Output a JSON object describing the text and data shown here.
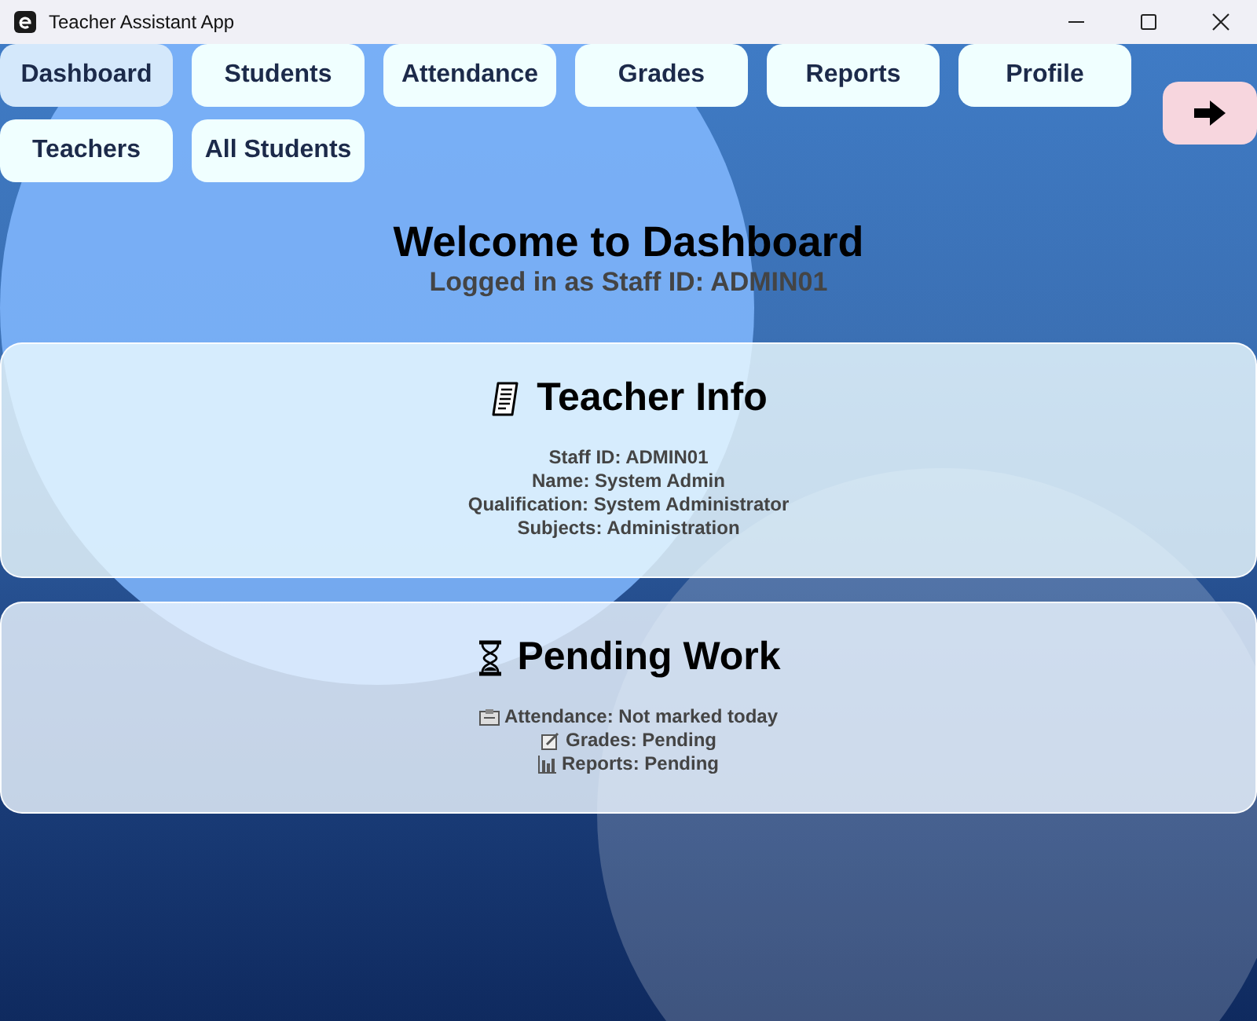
{
  "window": {
    "title": "Teacher Assistant App"
  },
  "tabs": [
    {
      "label": "Dashboard",
      "selected": true
    },
    {
      "label": "Students",
      "selected": false
    },
    {
      "label": "Attendance",
      "selected": false
    },
    {
      "label": "Grades",
      "selected": false
    },
    {
      "label": "Reports",
      "selected": false
    },
    {
      "label": "Profile",
      "selected": false
    },
    {
      "label": "Teachers",
      "selected": false
    },
    {
      "label": "All Students",
      "selected": false
    }
  ],
  "heading": "Welcome to Dashboard",
  "subheading": "Logged in as Staff ID: ADMIN01",
  "teacher_info": {
    "title": "Teacher Info",
    "lines": [
      "Staff ID: ADMIN01",
      "Name: System Admin",
      "Qualification: System Administrator",
      "Subjects: Administration"
    ]
  },
  "pending_work": {
    "title": "Pending Work",
    "items": [
      {
        "kind": "attendance",
        "text": "Attendance: Not marked today"
      },
      {
        "kind": "grades",
        "text": "Grades: Pending"
      },
      {
        "kind": "reports",
        "text": "Reports: Pending"
      }
    ]
  }
}
